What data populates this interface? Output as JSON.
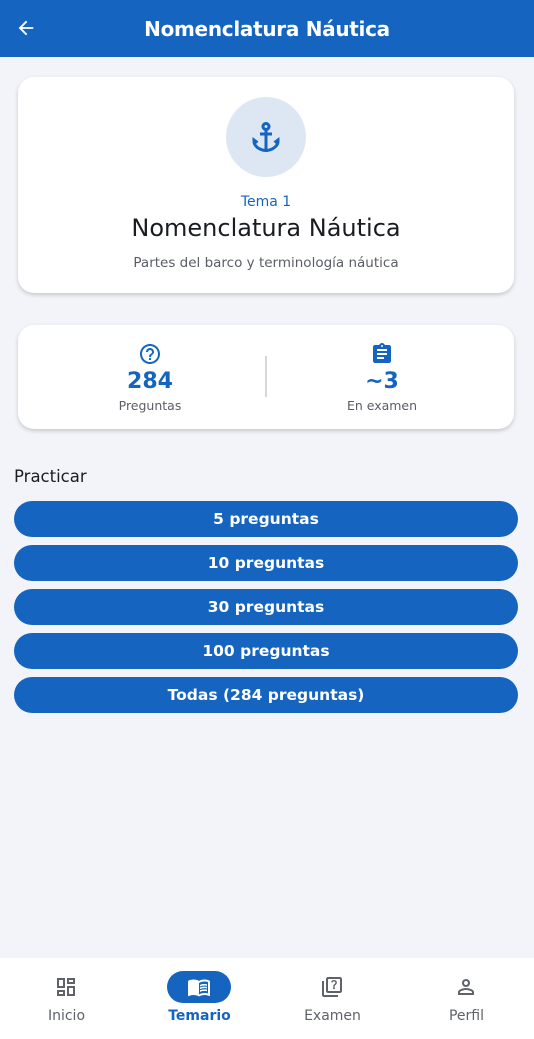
{
  "appbar": {
    "title": "Nomenclatura Náutica",
    "back_icon": "arrow-left-icon",
    "background_color": "#1565c0"
  },
  "topic": {
    "icon": "anchor-icon",
    "label": "Tema 1",
    "title": "Nomenclatura Náutica",
    "subtitle": "Partes del barco y terminología náutica"
  },
  "stats": {
    "questions": {
      "icon": "help-circle-icon",
      "value": "284",
      "label": "Preguntas"
    },
    "exam": {
      "icon": "clipboard-icon",
      "value": "~3",
      "label": "En examen"
    }
  },
  "practice": {
    "title": "Practicar",
    "buttons": [
      {
        "label": "5 preguntas"
      },
      {
        "label": "10 preguntas"
      },
      {
        "label": "30 preguntas"
      },
      {
        "label": "100 preguntas"
      },
      {
        "label": "Todas (284 preguntas)"
      }
    ]
  },
  "bottom_nav": {
    "items": [
      {
        "label": "Inicio",
        "icon": "dashboard-icon",
        "active": false
      },
      {
        "label": "Temario",
        "icon": "book-icon",
        "active": true
      },
      {
        "label": "Examen",
        "icon": "quiz-icon",
        "active": false
      },
      {
        "label": "Perfil",
        "icon": "person-icon",
        "active": false
      }
    ]
  },
  "colors": {
    "primary": "#1565c0",
    "background": "#f2f4f9",
    "icon_circle": "#dde7f4"
  }
}
